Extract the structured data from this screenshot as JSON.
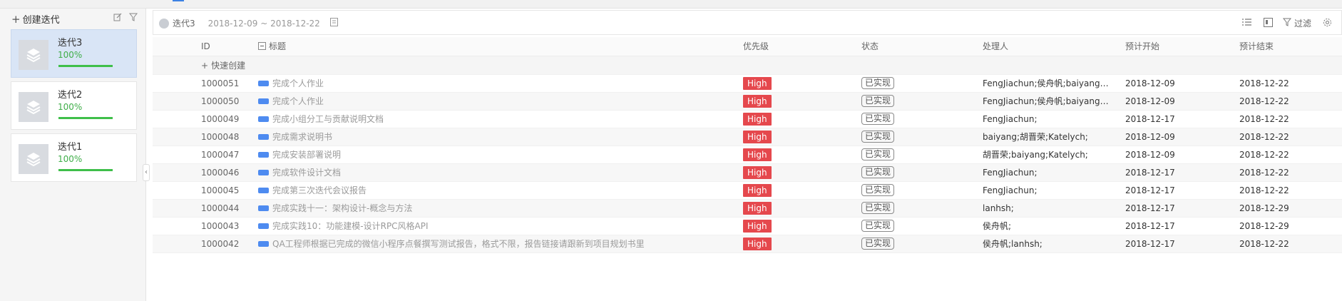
{
  "sidebar": {
    "create_label": "创建迭代",
    "iterations": [
      {
        "name": "迭代3",
        "progress_label": "100%",
        "progress": 1.0,
        "active": true
      },
      {
        "name": "迭代2",
        "progress_label": "100%",
        "progress": 1.0,
        "active": false
      },
      {
        "name": "迭代1",
        "progress_label": "100%",
        "progress": 1.0,
        "active": false
      }
    ]
  },
  "toolbar": {
    "iteration_title": "迭代3",
    "date_range": "2018-12-09 ~ 2018-12-22",
    "filter_label": "过滤"
  },
  "table": {
    "headers": {
      "id": "ID",
      "title": "标题",
      "priority": "优先级",
      "status": "状态",
      "assignee": "处理人",
      "start": "预计开始",
      "end": "预计结束"
    },
    "quick_create_label": "快速创建",
    "rows": [
      {
        "id": "1000051",
        "title": "完成个人作业",
        "priority": "High",
        "status": "已实现",
        "assignee": "FengJiachun;侯舟帆;baiyang;la...",
        "start": "2018-12-09",
        "end": "2018-12-22"
      },
      {
        "id": "1000050",
        "title": "完成个人作业",
        "priority": "High",
        "status": "已实现",
        "assignee": "FengJiachun;侯舟帆;baiyang;la...",
        "start": "2018-12-09",
        "end": "2018-12-22"
      },
      {
        "id": "1000049",
        "title": "完成小组分工与贡献说明文档",
        "priority": "High",
        "status": "已实现",
        "assignee": "FengJiachun;",
        "start": "2018-12-17",
        "end": "2018-12-22"
      },
      {
        "id": "1000048",
        "title": "完成需求说明书",
        "priority": "High",
        "status": "已实现",
        "assignee": "baiyang;胡晋荣;Katelych;",
        "start": "2018-12-09",
        "end": "2018-12-22"
      },
      {
        "id": "1000047",
        "title": "完成安装部署说明",
        "priority": "High",
        "status": "已实现",
        "assignee": "胡晋荣;baiyang;Katelych;",
        "start": "2018-12-09",
        "end": "2018-12-22"
      },
      {
        "id": "1000046",
        "title": "完成软件设计文档",
        "priority": "High",
        "status": "已实现",
        "assignee": "FengJiachun;",
        "start": "2018-12-17",
        "end": "2018-12-22"
      },
      {
        "id": "1000045",
        "title": "完成第三次迭代会议报告",
        "priority": "High",
        "status": "已实现",
        "assignee": "FengJiachun;",
        "start": "2018-12-17",
        "end": "2018-12-22"
      },
      {
        "id": "1000044",
        "title": "完成实践十一：架构设计-概念与方法",
        "priority": "High",
        "status": "已实现",
        "assignee": "lanhsh;",
        "start": "2018-12-17",
        "end": "2018-12-29"
      },
      {
        "id": "1000043",
        "title": "完成实践10：功能建模-设计RPC风格API",
        "priority": "High",
        "status": "已实现",
        "assignee": "侯舟帆;",
        "start": "2018-12-17",
        "end": "2018-12-29"
      },
      {
        "id": "1000042",
        "title": "QA工程师根据已完成的微信小程序点餐撰写测试报告，格式不限，报告链接请跟新到项目规划书里",
        "priority": "High",
        "status": "已实现",
        "assignee": "侯舟帆;lanhsh;",
        "start": "2018-12-17",
        "end": "2018-12-22"
      }
    ]
  }
}
